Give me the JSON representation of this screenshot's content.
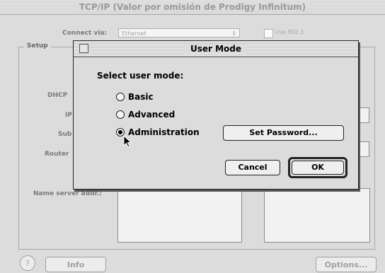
{
  "window": {
    "title": "TCP/IP (Valor por omisión de Prodigy Infinitum)"
  },
  "background": {
    "connect_via_label": "Connect via:",
    "connect_via_value": "Ethernet",
    "use_8023_label": "Use 802.3",
    "setup_label": "Setup",
    "dhcp_label": "DHCP",
    "ip_label": "IP",
    "subnet_label": "Sub",
    "router_label": "Router",
    "name_server_label": "Name server addr.:",
    "info_button": "Info",
    "options_button": "Options...",
    "help_glyph": "?"
  },
  "dialog": {
    "title": "User Mode",
    "prompt": "Select user mode:",
    "options": [
      {
        "label": "Basic",
        "selected": false
      },
      {
        "label": "Advanced",
        "selected": false
      },
      {
        "label": "Administration",
        "selected": true
      }
    ],
    "set_password_button": "Set Password...",
    "cancel_button": "Cancel",
    "ok_button": "OK"
  }
}
